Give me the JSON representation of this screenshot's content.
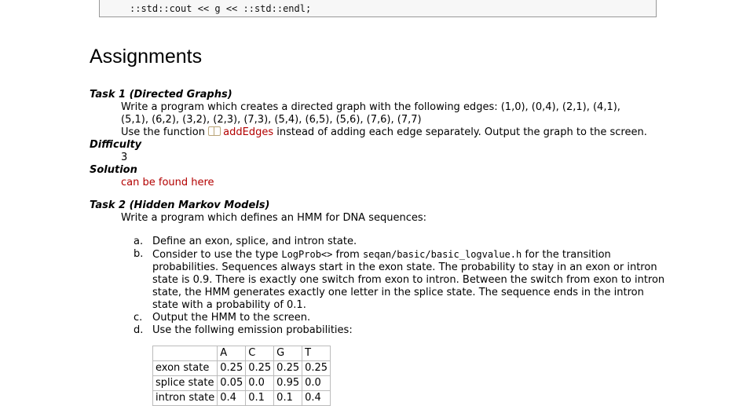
{
  "code_snippet": "::std::cout << g << ::std::endl;",
  "heading": "Assignments",
  "task1": {
    "title": "Task 1 (Directed Graphs)",
    "line1": "Write a program which creates a directed graph with the following edges: (1,0), (0,4), (2,1), (4,1),",
    "line2": "(5,1), (6,2), (3,2), (2,3), (7,3), (5,4), (6,5), (5,6), (7,6), (7,7)",
    "line3_pre": "Use the function",
    "line3_link": "addEdges",
    "line3_post": "instead of adding each edge separately. Output the graph to the screen.",
    "difficulty_label": "Difficulty",
    "difficulty_value": "3",
    "solution_label": "Solution",
    "solution_link": "can be found here"
  },
  "task2": {
    "title": "Task 2 (Hidden Markov Models)",
    "intro": "Write a program which defines an HMM for DNA sequences:",
    "steps": [
      {
        "mark": "a.",
        "text": "Define an exon, splice, and intron state."
      },
      {
        "mark": "b.",
        "pre": "Consider to use the type",
        "code1": "LogProb<>",
        "mid": "from",
        "code2": "seqan/basic/basic_logvalue.h",
        "post": "for the transition probabilities. Sequences always start in the exon state. The probability to stay in an exon or intron state is 0.9. There is exactly one switch from exon to intron. Between the switch from exon to intron state, the HMM generates exactly one letter in the splice state. The sequence ends in the intron state with a probability of 0.1."
      },
      {
        "mark": "c.",
        "text": "Output the HMM to the screen."
      },
      {
        "mark": "d.",
        "text": "Use the follwing emission probabilities:"
      }
    ],
    "table": {
      "headers": [
        "",
        "A",
        "C",
        "G",
        "T"
      ],
      "rows": [
        [
          "exon state",
          "0.25",
          "0.25",
          "0.25",
          "0.25"
        ],
        [
          "splice state",
          "0.05",
          "0.0",
          "0.95",
          "0.0"
        ],
        [
          "intron state",
          "0.4",
          "0.1",
          "0.1",
          "0.4"
        ]
      ]
    }
  }
}
